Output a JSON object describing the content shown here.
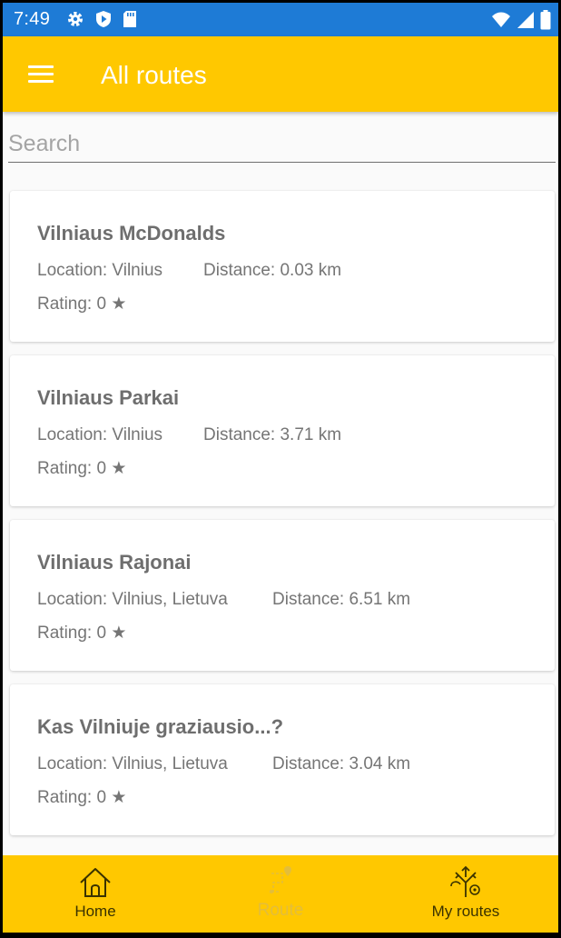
{
  "status_bar": {
    "time": "7:49",
    "icons_left": [
      "gear-icon",
      "shield-play-icon",
      "sd-card-icon"
    ],
    "icons_right": [
      "wifi-icon",
      "signal-icon",
      "battery-icon"
    ],
    "color": "#1e7bd6"
  },
  "app_bar": {
    "title": "All routes",
    "menu_icon": "hamburger-menu-icon",
    "color": "#ffc800"
  },
  "search": {
    "placeholder": "Search",
    "value": ""
  },
  "routes": [
    {
      "title": "Vilniaus McDonalds",
      "location": "Location: Vilnius",
      "distance": "Distance: 0.03  km",
      "rating": "Rating: 0 ★"
    },
    {
      "title": "Vilniaus Parkai",
      "location": "Location: Vilnius",
      "distance": "Distance: 3.71  km",
      "rating": "Rating: 0 ★"
    },
    {
      "title": "Vilniaus Rajonai",
      "location": "Location: Vilnius, Lietuva",
      "distance": "Distance: 6.51  km",
      "rating": "Rating: 0 ★"
    },
    {
      "title": "Kas Vilniuje graziausio...?",
      "location": "Location: Vilnius, Lietuva",
      "distance": "Distance: 3.04  km",
      "rating": "Rating: 0 ★"
    }
  ],
  "bottom_nav": {
    "items": [
      {
        "label": "Home",
        "icon": "home-icon",
        "enabled": true
      },
      {
        "label": "Route",
        "icon": "route-icon",
        "enabled": false
      },
      {
        "label": "My routes",
        "icon": "my-routes-icon",
        "enabled": true
      }
    ]
  }
}
